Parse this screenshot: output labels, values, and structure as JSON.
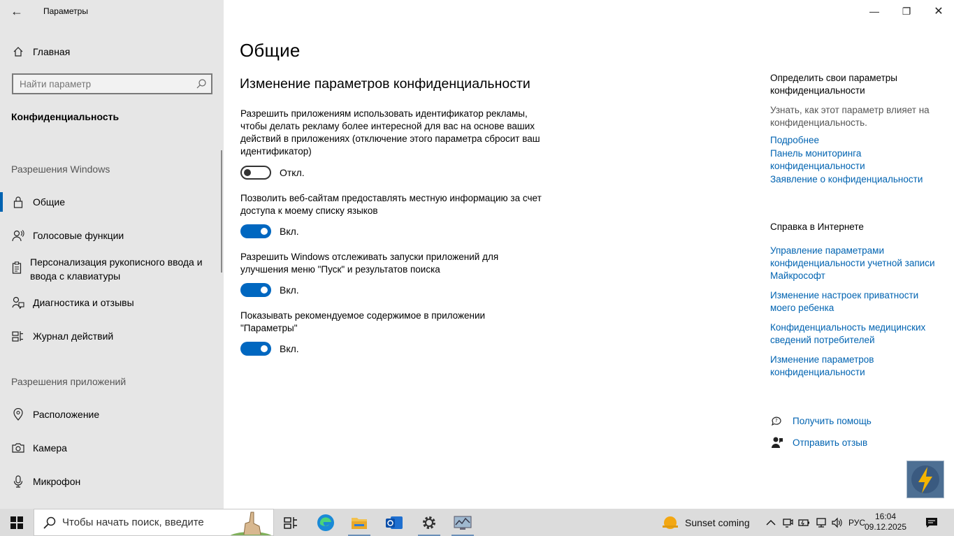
{
  "window": {
    "title": "Параметры",
    "back_label": "←",
    "minimize": "—",
    "maximize": "❐",
    "close": "✕"
  },
  "sidebar": {
    "home": "Главная",
    "search_placeholder": "Найти параметр",
    "category": "Конфиденциальность",
    "section_windows": "Разрешения Windows",
    "section_apps": "Разрешения приложений",
    "items": [
      {
        "label": "Общие",
        "icon": "lock-icon"
      },
      {
        "label": "Голосовые функции",
        "icon": "speech-icon"
      },
      {
        "label": "Персонализация рукописного ввода и ввода с клавиатуры",
        "icon": "clipboard-icon"
      },
      {
        "label": "Диагностика и отзывы",
        "icon": "diagnostics-icon"
      },
      {
        "label": "Журнал действий",
        "icon": "timeline-icon"
      },
      {
        "label": "Расположение",
        "icon": "location-icon"
      },
      {
        "label": "Камера",
        "icon": "camera-icon"
      },
      {
        "label": "Микрофон",
        "icon": "microphone-icon"
      }
    ]
  },
  "main": {
    "title": "Общие",
    "subtitle": "Изменение параметров конфиденциальности",
    "options": [
      {
        "text": "Разрешить приложениям использовать идентификатор рекламы, чтобы делать рекламу более интересной для вас на основе ваших действий в приложениях (отключение этого параметра сбросит ваш идентификатор)",
        "state": "Откл.",
        "on": false
      },
      {
        "text": "Позволить веб-сайтам предоставлять местную информацию за счет доступа к моему списку языков",
        "state": "Вкл.",
        "on": true
      },
      {
        "text": "Разрешить Windows отслеживать запуски приложений для улучшения меню \"Пуск\" и результатов поиска",
        "state": "Вкл.",
        "on": true
      },
      {
        "text": "Показывать рекомендуемое содержимое в приложении \"Параметры\"",
        "state": "Вкл.",
        "on": true
      }
    ]
  },
  "right": {
    "choose_title": "Определить свои параметры конфиденциальности",
    "choose_desc": "Узнать, как этот параметр влияет на конфиденциальность.",
    "links1": [
      "Подробнее",
      "Панель мониторинга конфиденциальности",
      "Заявление о конфиденциальности"
    ],
    "web_help_title": "Справка в Интернете",
    "links2": [
      "Управление параметрами конфиденциальности учетной записи Майкрософт",
      "Изменение настроек приватности моего ребенка",
      "Конфиденциальность медицинских сведений потребителей",
      "Изменение параметров конфиденциальности"
    ],
    "get_help": "Получить помощь",
    "feedback": "Отправить отзыв"
  },
  "taskbar": {
    "search_text": "Чтобы начать поиск, введите",
    "weather": "Sunset coming",
    "lang": "РУС",
    "time": "16:04",
    "date": "09.12.2025"
  },
  "colors": {
    "accent": "#0067c0",
    "link": "#0063b1",
    "sidebar_bg": "#e6e6e6"
  }
}
